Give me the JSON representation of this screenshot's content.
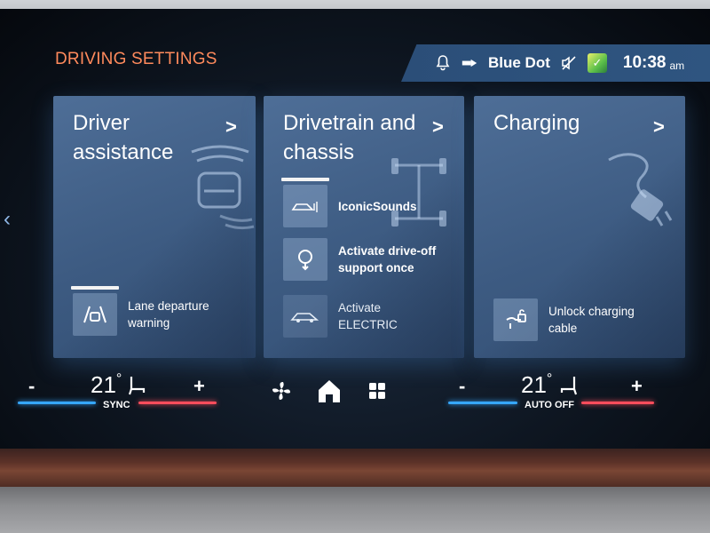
{
  "header": {
    "title": "DRIVING SETTINGS"
  },
  "status": {
    "device": "Blue Dot",
    "time": "10:38",
    "ampm": "am",
    "icons": [
      "bell-icon",
      "phone-battery-icon",
      "mute-icon",
      "app-badge-icon"
    ]
  },
  "cards": [
    {
      "title": "Driver assistance",
      "chevron": ">",
      "illustration": "car-radar-icon",
      "items": [
        {
          "label": "Lane departure warning",
          "icon": "lane-departure-icon"
        }
      ]
    },
    {
      "title": "Drivetrain and chassis",
      "chevron": ">",
      "illustration": "axle-icon",
      "items": [
        {
          "label": "IconicSounds",
          "icon": "car-sound-icon"
        },
        {
          "label": "Activate drive-off support once",
          "icon": "drive-off-icon"
        },
        {
          "label": "Activate ELECTRIC",
          "icon": "electric-car-icon"
        }
      ]
    },
    {
      "title": "Charging",
      "chevron": ">",
      "illustration": "charging-plug-icon",
      "items": [
        {
          "label": "Unlock charging cable",
          "icon": "unlock-cable-icon"
        }
      ]
    }
  ],
  "climate": {
    "left": {
      "minus": "-",
      "temp": "21",
      "deg": "°",
      "label": "SYNC",
      "plus": "+"
    },
    "right": {
      "minus": "-",
      "temp": "21",
      "deg": "°",
      "label": "AUTO OFF",
      "plus": "+"
    }
  },
  "colors": {
    "title": "#ff8a5c",
    "card": "#4a6a93",
    "status_bar": "#2f5580",
    "heat_line": "#ff4d5c",
    "cool_line": "#36a7ff"
  }
}
